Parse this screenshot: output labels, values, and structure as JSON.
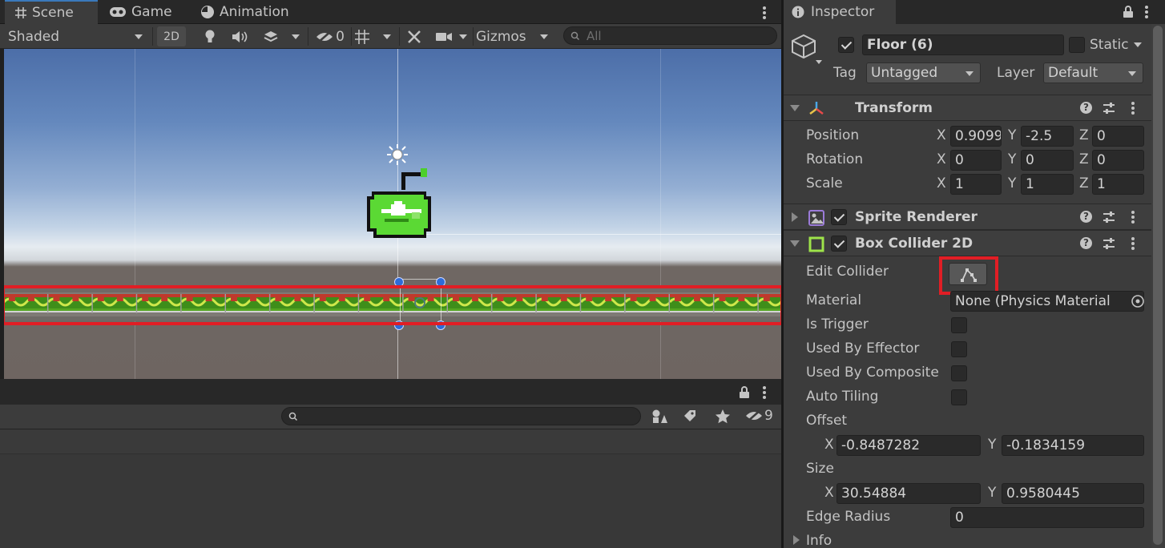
{
  "scene_tabs": [
    {
      "label": "Scene",
      "icon": "grid-icon",
      "active": true
    },
    {
      "label": "Game",
      "icon": "gamepad-icon",
      "active": false
    },
    {
      "label": "Animation",
      "icon": "animation-clock-icon",
      "active": false
    }
  ],
  "scene_toolbar": {
    "shading_mode": "Shaded",
    "mode_2d": "2D",
    "hidden_count": "0",
    "gizmos": "Gizmos",
    "search_placeholder": "All"
  },
  "lower_panel": {
    "hidden_count": "9",
    "search_placeholder": ""
  },
  "inspector": {
    "tab_label": "Inspector",
    "object_name": "Floor (6)",
    "active": true,
    "static_label": "Static",
    "tag_label": "Tag",
    "tag_value": "Untagged",
    "layer_label": "Layer",
    "layer_value": "Default",
    "transform": {
      "title": "Transform",
      "position_label": "Position",
      "rotation_label": "Rotation",
      "scale_label": "Scale",
      "position": {
        "x": "0.9099",
        "y": "-2.5",
        "z": "0"
      },
      "rotation": {
        "x": "0",
        "y": "0",
        "z": "0"
      },
      "scale": {
        "x": "1",
        "y": "1",
        "z": "1"
      }
    },
    "sprite_renderer": {
      "title": "Sprite Renderer",
      "enabled": true
    },
    "box_collider": {
      "title": "Box Collider 2D",
      "enabled": true,
      "edit_collider_label": "Edit Collider",
      "material_label": "Material",
      "material_value": "None (Physics Material",
      "is_trigger_label": "Is Trigger",
      "used_by_effector_label": "Used By Effector",
      "used_by_composite_label": "Used By Composite",
      "auto_tiling_label": "Auto Tiling",
      "offset_label": "Offset",
      "offset": {
        "x": "-0.8487282",
        "y": "-0.1834159"
      },
      "size_label": "Size",
      "size": {
        "x": "30.54884",
        "y": "0.9580445"
      },
      "edge_radius_label": "Edge Radius",
      "edge_radius": "0",
      "info_label": "Info"
    }
  },
  "axis_labels": {
    "x": "X",
    "y": "Y",
    "z": "Z"
  },
  "colors": {
    "highlight": "#e11e25",
    "apple_green": "#55d62a",
    "ground_green": "#4aa81e",
    "ground_red": "#c0392b"
  }
}
